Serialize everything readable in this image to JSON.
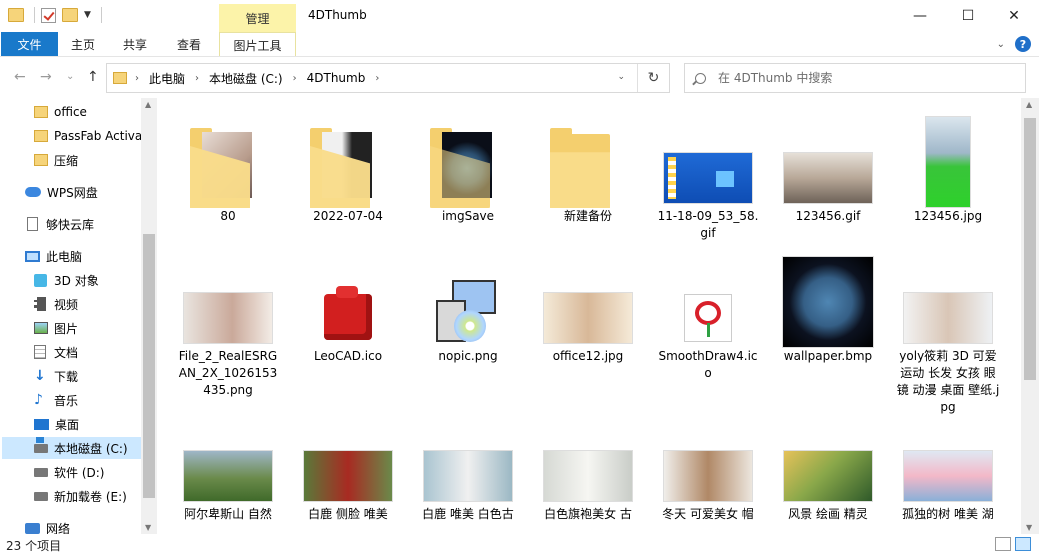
{
  "window": {
    "title": "4DThumb",
    "context_group": "管理",
    "controls": {
      "minimize": "—",
      "maximize": "☐",
      "close": "✕"
    }
  },
  "ribbon": {
    "tabs": [
      "文件",
      "主页",
      "共享",
      "查看",
      "图片工具"
    ],
    "help": "?",
    "collapse": "⌄"
  },
  "nav": {
    "back": "←",
    "forward": "→",
    "recent": "⌄",
    "up": "↑",
    "refresh": "↻",
    "breadcrumb": [
      "此电脑",
      "本地磁盘 (C:)",
      "4DThumb"
    ],
    "crumb_sep": "›",
    "dropdown": "⌄"
  },
  "search": {
    "placeholder": "在 4DThumb 中搜索"
  },
  "sidebar": {
    "items": [
      {
        "label": "office",
        "icon": "folder-icon"
      },
      {
        "label": "PassFab Activa",
        "icon": "folder-icon"
      },
      {
        "label": "压缩",
        "icon": "folder-icon"
      },
      {
        "label": "WPS网盘",
        "icon": "cloud-icon"
      },
      {
        "label": "够快云库",
        "icon": "document-icon"
      },
      {
        "label": "此电脑",
        "icon": "computer-icon"
      },
      {
        "label": "3D 对象",
        "icon": "cube-icon"
      },
      {
        "label": "视频",
        "icon": "video-icon"
      },
      {
        "label": "图片",
        "icon": "pictures-icon"
      },
      {
        "label": "文档",
        "icon": "documents-icon"
      },
      {
        "label": "下载",
        "icon": "download-icon"
      },
      {
        "label": "音乐",
        "icon": "music-icon"
      },
      {
        "label": "桌面",
        "icon": "desktop-icon"
      },
      {
        "label": "本地磁盘 (C:)",
        "icon": "system-drive-icon",
        "selected": true
      },
      {
        "label": "软件 (D:)",
        "icon": "drive-icon"
      },
      {
        "label": "新加载卷 (E:)",
        "icon": "drive-icon"
      },
      {
        "label": "网络",
        "icon": "network-icon"
      }
    ]
  },
  "files": [
    {
      "name": "80",
      "kind": "folder"
    },
    {
      "name": "2022-07-04",
      "kind": "folder"
    },
    {
      "name": "imgSave",
      "kind": "folder"
    },
    {
      "name": "新建备份",
      "kind": "folder"
    },
    {
      "name": "11-18-09_53_58.gif",
      "kind": "image"
    },
    {
      "name": "123456.gif",
      "kind": "image"
    },
    {
      "name": "123456.jpg",
      "kind": "image"
    },
    {
      "name": "File_2_RealESRGAN_2X_1026153435.png",
      "kind": "image"
    },
    {
      "name": "LeoCAD.ico",
      "kind": "icon"
    },
    {
      "name": "nopic.png",
      "kind": "icon"
    },
    {
      "name": "office12.jpg",
      "kind": "image"
    },
    {
      "name": "SmoothDraw4.ico",
      "kind": "icon"
    },
    {
      "name": "wallpaper.bmp",
      "kind": "image"
    },
    {
      "name": "yoly筱莉 3D 可爱 运动 长发 女孩 眼镜 动漫 桌面 壁纸.jpg",
      "kind": "image"
    },
    {
      "name": "阿尔卑斯山 自然",
      "kind": "image"
    },
    {
      "name": "白鹿 侧脸 唯美",
      "kind": "image"
    },
    {
      "name": "白鹿 唯美 白色古",
      "kind": "image"
    },
    {
      "name": "白色旗袍美女 古",
      "kind": "image"
    },
    {
      "name": "冬天 可爱美女 帽",
      "kind": "image"
    },
    {
      "name": "风景 绘画 精灵",
      "kind": "image"
    },
    {
      "name": "孤独的树 唯美 湖",
      "kind": "image"
    }
  ],
  "status": {
    "count": "23 个项目"
  },
  "colors": {
    "accent": "#1979ca",
    "selected": "#cce8ff",
    "context_tab": "#fcf3a9",
    "folder": "#f4cf6e"
  }
}
